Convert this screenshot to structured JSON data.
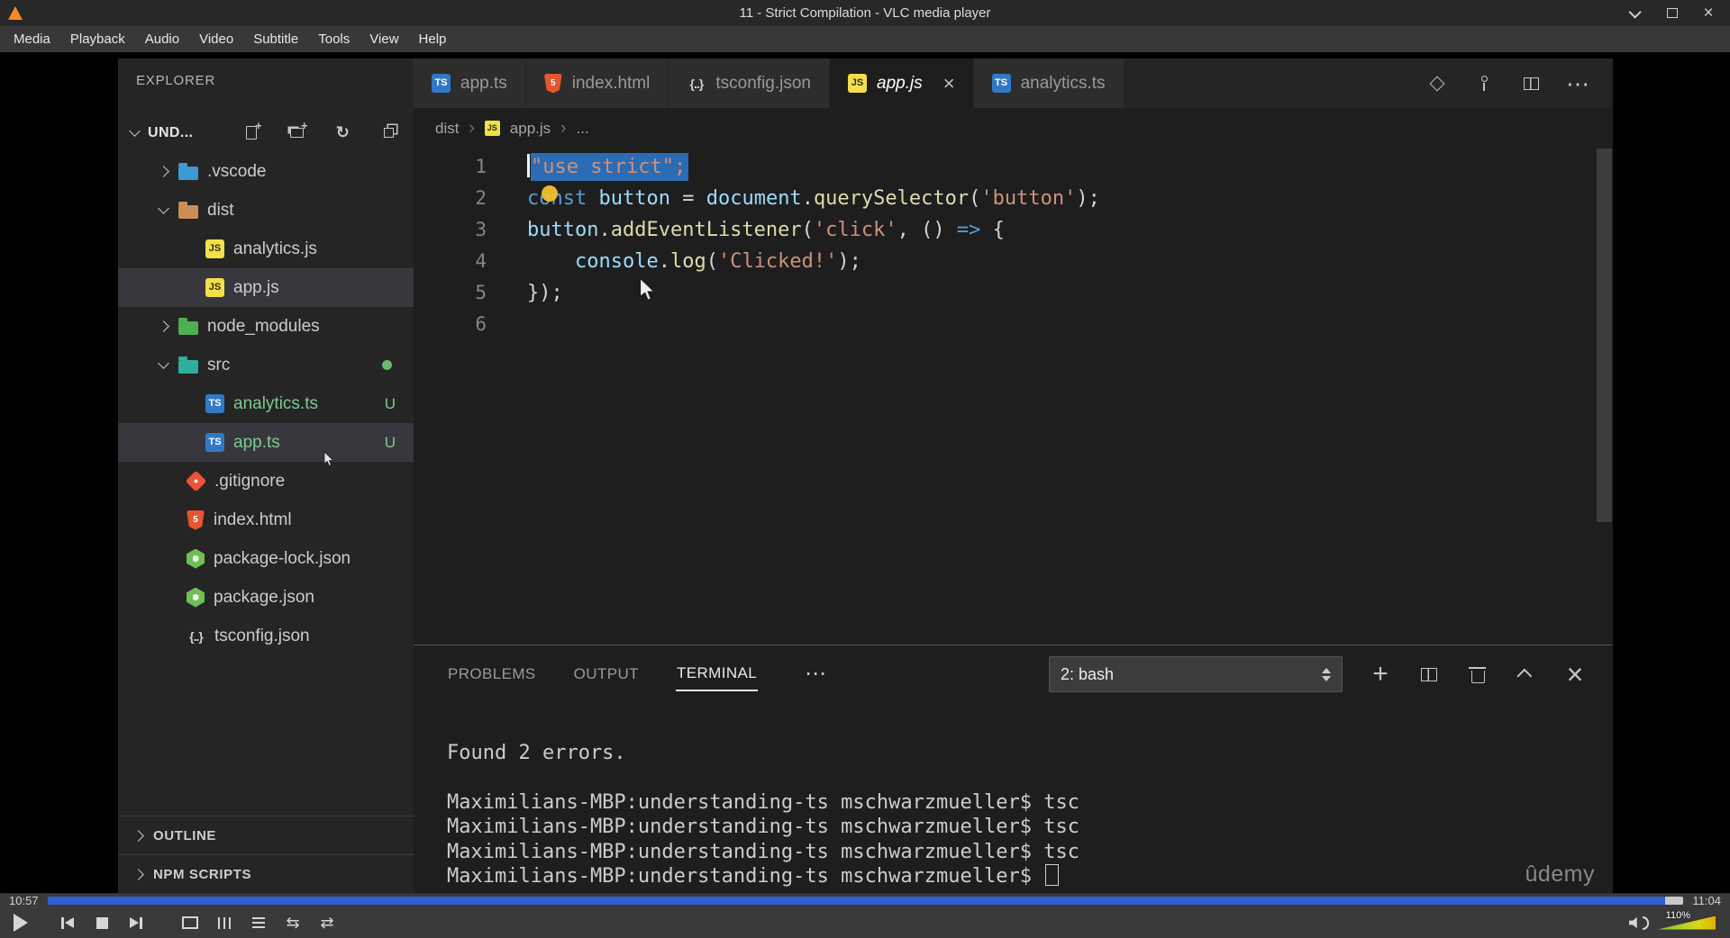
{
  "window": {
    "title": "11 - Strict Compilation - VLC media player",
    "menu_items": [
      "Media",
      "Playback",
      "Audio",
      "Video",
      "Subtitle",
      "Tools",
      "View",
      "Help"
    ],
    "controls": [
      "minimize",
      "maximize",
      "close"
    ]
  },
  "player": {
    "time_elapsed": "10:57",
    "time_total": "11:04",
    "progress_percent": 98.9,
    "volume_label": "110%",
    "accent_blue": "#2e5fd3",
    "buttons": [
      "play",
      "previous",
      "stop",
      "next",
      "fullscreen",
      "extended-settings",
      "playlist",
      "loop",
      "random"
    ]
  },
  "vscode": {
    "explorer": {
      "header": "EXPLORER",
      "workspace_label": "UND...",
      "actions": [
        "new-file",
        "new-folder",
        "refresh",
        "collapse-folders"
      ],
      "tree": [
        {
          "label": ".vscode",
          "icon": "folder-vscode",
          "kind": "folder",
          "chevron": "collapsed"
        },
        {
          "label": "dist",
          "icon": "folder-dist",
          "kind": "folder",
          "chevron": "expanded"
        },
        {
          "label": "analytics.js",
          "icon": "js",
          "kind": "child"
        },
        {
          "label": "app.js",
          "icon": "js",
          "kind": "child",
          "selected": true
        },
        {
          "label": "node_modules",
          "icon": "folder-node",
          "kind": "folder",
          "chevron": "collapsed"
        },
        {
          "label": "src",
          "icon": "folder-src",
          "kind": "folder",
          "chevron": "expanded",
          "badge": "dot"
        },
        {
          "label": "analytics.ts",
          "icon": "ts",
          "kind": "child",
          "git": "untracked",
          "badge": "U"
        },
        {
          "label": "app.ts",
          "icon": "ts",
          "kind": "child",
          "git": "untracked",
          "badge": "U",
          "selected": true
        },
        {
          "label": ".gitignore",
          "icon": "git",
          "kind": "root"
        },
        {
          "label": "index.html",
          "icon": "html",
          "kind": "root"
        },
        {
          "label": "package-lock.json",
          "icon": "npm",
          "kind": "root"
        },
        {
          "label": "package.json",
          "icon": "npm",
          "kind": "root"
        },
        {
          "label": "tsconfig.json",
          "icon": "json",
          "kind": "root"
        }
      ],
      "sections": [
        "OUTLINE",
        "NPM SCRIPTS"
      ]
    },
    "editor_tabs": [
      {
        "label": "app.ts",
        "icon": "ts"
      },
      {
        "label": "index.html",
        "icon": "html"
      },
      {
        "label": "tsconfig.json",
        "icon": "json"
      },
      {
        "label": "app.js",
        "icon": "js",
        "active": true,
        "italic": true
      },
      {
        "label": "analytics.ts",
        "icon": "ts"
      }
    ],
    "editor_actions": [
      "open-changes",
      "git-branch",
      "split-editor",
      "more-actions"
    ],
    "breadcrumb": [
      {
        "label": "dist"
      },
      {
        "label": "app.js",
        "icon": "js"
      },
      {
        "label": "..."
      }
    ],
    "code": {
      "lines": [
        {
          "n": "1",
          "segs": [
            {
              "t": "\"use strict\";",
              "c": "str",
              "sel": true
            }
          ]
        },
        {
          "n": "2",
          "segs": [
            {
              "t": "const",
              "c": "kw"
            },
            {
              "t": " ",
              "c": "pln"
            },
            {
              "t": "button",
              "c": "var"
            },
            {
              "t": " = ",
              "c": "pln"
            },
            {
              "t": "document",
              "c": "var"
            },
            {
              "t": ".",
              "c": "pln"
            },
            {
              "t": "querySelector",
              "c": "fn"
            },
            {
              "t": "(",
              "c": "pln"
            },
            {
              "t": "'button'",
              "c": "str"
            },
            {
              "t": ");",
              "c": "pln"
            }
          ]
        },
        {
          "n": "3",
          "segs": [
            {
              "t": "button",
              "c": "var"
            },
            {
              "t": ".",
              "c": "pln"
            },
            {
              "t": "addEventListener",
              "c": "fn"
            },
            {
              "t": "(",
              "c": "pln"
            },
            {
              "t": "'click'",
              "c": "str"
            },
            {
              "t": ", () ",
              "c": "pln"
            },
            {
              "t": "=>",
              "c": "kw"
            },
            {
              "t": " {",
              "c": "pln"
            }
          ]
        },
        {
          "n": "4",
          "segs": [
            {
              "t": "    ",
              "c": "pln"
            },
            {
              "t": "console",
              "c": "var"
            },
            {
              "t": ".",
              "c": "pln"
            },
            {
              "t": "log",
              "c": "fn"
            },
            {
              "t": "(",
              "c": "pln"
            },
            {
              "t": "'Clicked!'",
              "c": "str"
            },
            {
              "t": ");",
              "c": "pln"
            }
          ]
        },
        {
          "n": "5",
          "segs": [
            {
              "t": "});",
              "c": "pln"
            }
          ]
        },
        {
          "n": "6",
          "segs": []
        }
      ]
    },
    "panel": {
      "tabs": [
        "PROBLEMS",
        "OUTPUT",
        "TERMINAL"
      ],
      "active_tab": "TERMINAL",
      "more": "⋯",
      "shell_selector": "2: bash",
      "actions": [
        "new-terminal",
        "split-terminal",
        "kill-terminal",
        "maximize-panel",
        "close-panel"
      ],
      "terminal_lines": [
        "Found 2 errors.",
        "",
        "Maximilians-MBP:understanding-ts mschwarzmueller$ tsc",
        "Maximilians-MBP:understanding-ts mschwarzmueller$ tsc",
        "Maximilians-MBP:understanding-ts mschwarzmueller$ tsc",
        "Maximilians-MBP:understanding-ts mschwarzmueller$ "
      ]
    },
    "watermark": "ûdemy"
  }
}
